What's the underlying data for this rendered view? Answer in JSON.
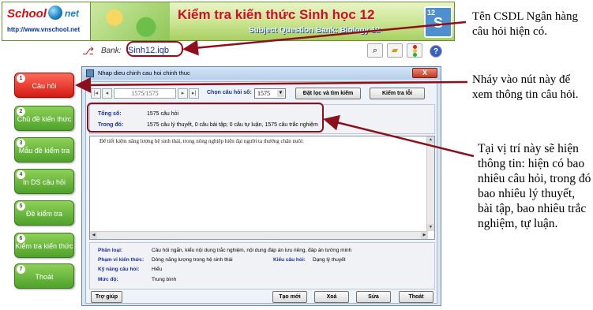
{
  "banner": {
    "logo_school": "School",
    "logo_net": "net",
    "logo_url": "http://www.vnschool.net",
    "title": "Kiểm tra kiến thức Sinh học 12",
    "subtitle": "Subject Question Bank: Biology 12",
    "badge_letter": "S",
    "badge_number": "12"
  },
  "bank": {
    "label": "Bank:",
    "value": "Sinh12.iqb"
  },
  "toolbar": {
    "icons": [
      "search-icon",
      "folder-icon",
      "traffic-light-icon",
      "help-icon"
    ],
    "help_label": "?"
  },
  "menu": {
    "items": [
      {
        "num": "1",
        "label": "Câu hỏi"
      },
      {
        "num": "2",
        "label": "Chủ đề kiến thức"
      },
      {
        "num": "3",
        "label": "Mẫu đề kiểm tra"
      },
      {
        "num": "4",
        "label": "In DS câu hỏi"
      },
      {
        "num": "5",
        "label": "Đề kiểm tra"
      },
      {
        "num": "6",
        "label": "Kiểm tra kiến thức"
      },
      {
        "num": "7",
        "label": "Thoát"
      }
    ]
  },
  "dialog": {
    "title": "Nhap dieu chinh cau hoi chinh thuc",
    "close": "X",
    "record": "1575/1575",
    "nav": {
      "first": "|◂",
      "prev": "◂",
      "next": "▸",
      "last": "▸|"
    },
    "choose_label": "Chọn câu hỏi số:",
    "choose_value": "1575",
    "filter_button": "Đặt lọc và tìm kiếm",
    "check_button": "Kiểm tra lỗi",
    "total_label": "Tổng số:",
    "total_value": "1575 câu hỏi",
    "among_label": "Trong đó:",
    "among_value": "1575 câu lý thuyết, 0 câu bài tập; 0 câu tự luận, 1575 câu trắc nghiệm",
    "content_text": "Để tiết kiệm năng lượng hệ sinh thái, trong nông nghiệp hiện đại người ta thường chăn nuôi:",
    "meta": {
      "type_label": "Phân loại:",
      "type_value": "Câu hỏi ngắn, kiểu nội dung trắc nghiệm, nội dung đáp án lưu riêng, đáp án tường minh",
      "scope_label": "Phạm vi kiến thức:",
      "scope_value": "Dòng năng lượng trong hệ sinh thái",
      "qtype_label": "Kiểu câu hỏi:",
      "qtype_value": "Dạng lý thuyết",
      "skill_label": "Kỹ năng câu hỏi:",
      "skill_value": "Hiểu",
      "level_label": "Mức độ:",
      "level_value": "Trung bình"
    },
    "buttons": {
      "help": "Trợ giúp",
      "new": "Tạo mới",
      "delete": "Xoá",
      "edit": "Sửa",
      "exit": "Thoát"
    }
  },
  "callouts": {
    "c1": "Tên CSDL Ngân hàng câu hỏi hiện có.",
    "c2": "Nháy vào nút này để xem thông tin câu hỏi.",
    "c3": "Tại vị trí này sẽ hiện thông tin: hiện có bao nhiêu câu hỏi, trong đó bao nhiêu lý thuyết, bài tập, bao nhiêu trắc nghiệm, tự luận."
  },
  "colors": {
    "annotation": "#8e0f1a",
    "active_menu": "#d41a12",
    "menu": "#4ea12a",
    "label_blue": "#1a2f9c"
  }
}
